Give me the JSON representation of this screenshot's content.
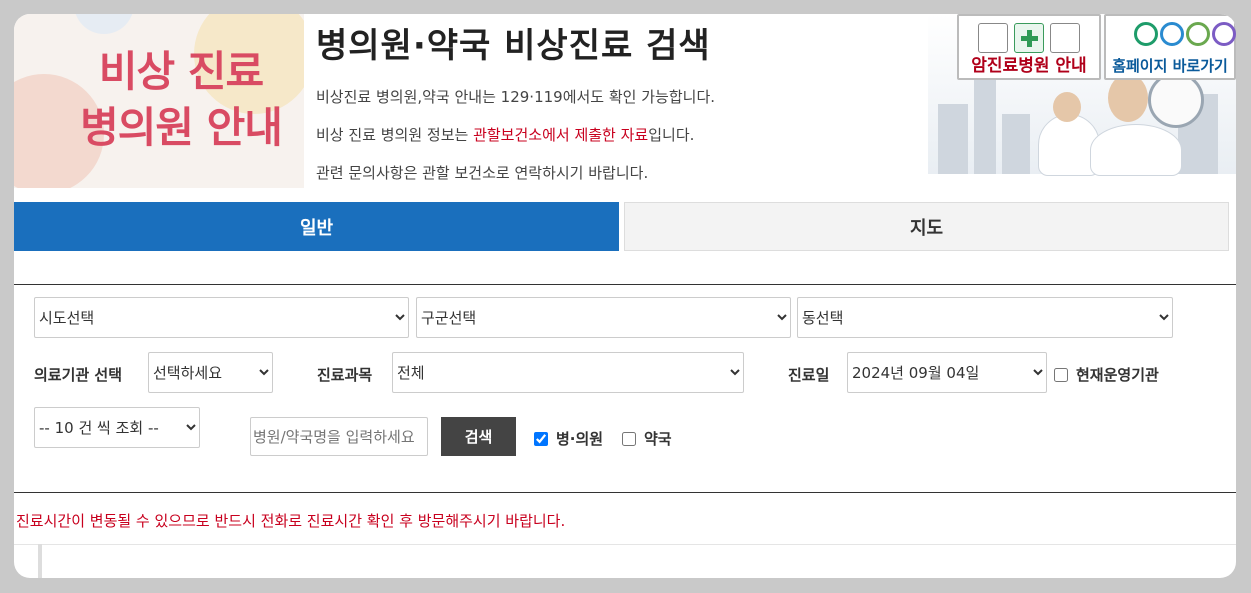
{
  "banner": {
    "image_text_line1": "비상 진료",
    "image_text_line2": "병의원 안내",
    "title": "병의원·약국 비상진료 검색",
    "info_line1": "비상진료 병의원,약국 안내는 129·119에서도 확인 가능합니다.",
    "info_line2_prefix": "비상 진료 병의원 정보는 ",
    "info_line2_highlight": "관할보건소에서 제출한 자료",
    "info_line2_suffix": "입니다.",
    "info_line3": "관련 문의사항은 관할 보건소로 연락하시기 바랍니다."
  },
  "quick_links": {
    "cancer_label": "암진료병원 안내",
    "home_label": "홈페이지 바로가기"
  },
  "tabs": [
    {
      "label": "일반",
      "active": true
    },
    {
      "label": "지도",
      "active": false
    }
  ],
  "filters": {
    "sido": "시도선택",
    "gugun": "구군선택",
    "dong": "동선택",
    "institution_label": "의료기관 선택",
    "institution_value": "선택하세요",
    "department_label": "진료과목",
    "department_value": "전체",
    "date_label": "진료일",
    "date_value": "2024년 09월 04일",
    "currently_open_label": "현재운영기관",
    "currently_open_checked": false,
    "page_size": "-- 10 건 씩 조회 --",
    "search_placeholder": "병원/약국명을 입력하세요",
    "search_button": "검색",
    "hospital_label": "병·의원",
    "hospital_checked": true,
    "pharmacy_label": "약국",
    "pharmacy_checked": false
  },
  "notice": "진료시간이 변동될 수 있으므로 반드시 전화로 진료시간 확인 후 방문해주시기 바랍니다.",
  "colors": {
    "accent_blue": "#1a6fbd",
    "notice_red": "#c8001e",
    "banner_pink": "#d94b63"
  }
}
